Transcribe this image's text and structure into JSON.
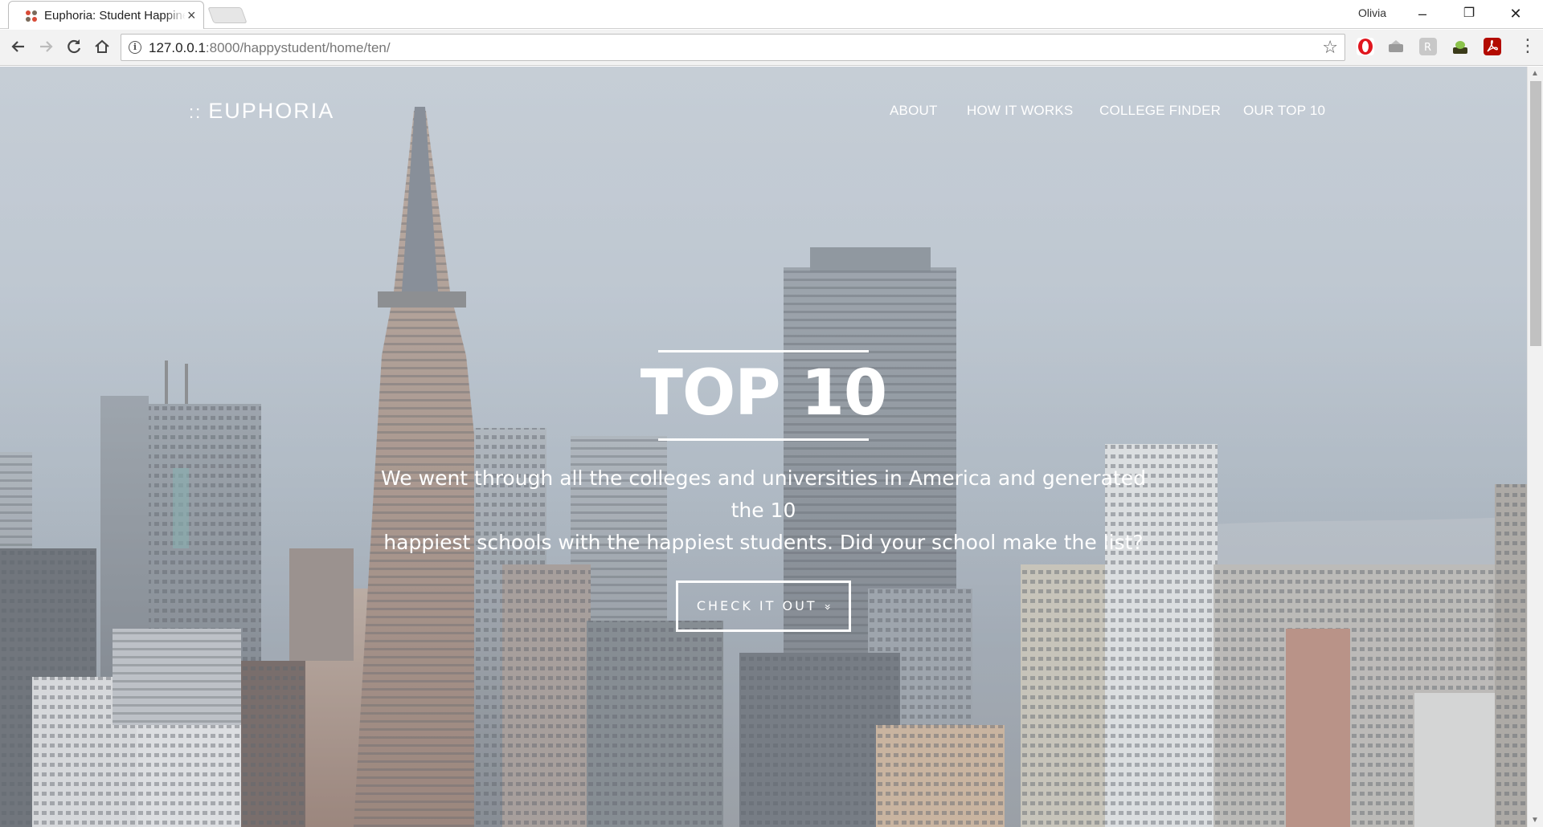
{
  "browser": {
    "tab_title": "Euphoria: Student Happiness",
    "tab_close": "×",
    "profile_name": "Olivia",
    "url_host": "127.0.0.1",
    "url_rest": ":8000/happystudent/home/ten/",
    "window_buttons": {
      "minimize": "–",
      "restore": "❐",
      "close": "✕"
    },
    "nav_icons": [
      "back-icon",
      "forward-icon",
      "reload-icon",
      "home-icon"
    ],
    "extensions": [
      "opera-icon",
      "drive-icon",
      "reader-icon",
      "extension-icon",
      "pdf-icon"
    ],
    "colors": {
      "opera": "#e0161e",
      "pdf": "#b30b00"
    }
  },
  "site": {
    "brand_colons": "::",
    "brand_name": "EUPHORIA",
    "nav": [
      "ABOUT",
      "HOW IT WORKS",
      "COLLEGE FINDER",
      "OUR TOP 10"
    ],
    "hero": {
      "title": "TOP 10",
      "line1": "We went through all the colleges and universities in America and generated the 10",
      "line2": "happiest schools with the happiest students. Did your school make the list?",
      "cta_label": "CHECK IT OUT",
      "cta_chevron": "»"
    }
  }
}
